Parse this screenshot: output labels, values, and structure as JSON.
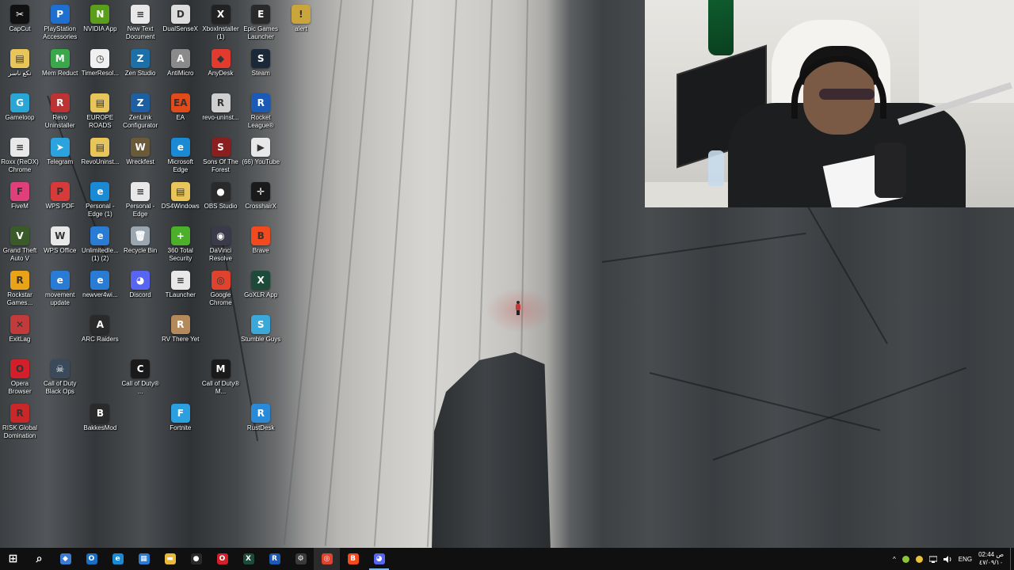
{
  "desktop": {
    "icons": [
      {
        "label": "CapCut",
        "glyph": "✂",
        "color": "#111111",
        "col": 0,
        "row": 0
      },
      {
        "label": "PlayStation Accessories",
        "glyph": "P",
        "color": "#1f6fd1",
        "col": 1,
        "row": 0
      },
      {
        "label": "NVIDIA App",
        "glyph": "N",
        "color": "#5a9e1b",
        "col": 2,
        "row": 0
      },
      {
        "label": "New Text Document",
        "glyph": "≡",
        "color": "#e8e8e8",
        "col": 3,
        "row": 0
      },
      {
        "label": "DualSenseX",
        "glyph": "D",
        "color": "#dcdcdc",
        "col": 4,
        "row": 0
      },
      {
        "label": "XboxInstaller (1)",
        "glyph": "X",
        "color": "#222222",
        "col": 5,
        "row": 0
      },
      {
        "label": "Epic Games Launcher",
        "glyph": "E",
        "color": "#2a2a2a",
        "col": 6,
        "row": 0
      },
      {
        "label": "alert",
        "glyph": "!",
        "color": "#c9a53b",
        "col": 7,
        "row": 0
      },
      {
        "label": "نكع ناسر",
        "glyph": "▤",
        "color": "#e7c55a",
        "col": 0,
        "row": 1
      },
      {
        "label": "Mem Reduct",
        "glyph": "M",
        "color": "#3aa84a",
        "col": 1,
        "row": 1
      },
      {
        "label": "TimerResol...",
        "glyph": "◷",
        "color": "#f0f0f0",
        "col": 2,
        "row": 1
      },
      {
        "label": "Zen Studio",
        "glyph": "Z",
        "color": "#1d6fa8",
        "col": 3,
        "row": 1
      },
      {
        "label": "AntiMicro",
        "glyph": "A",
        "color": "#8a8a8a",
        "col": 4,
        "row": 1
      },
      {
        "label": "AnyDesk",
        "glyph": "◆",
        "color": "#e23a2e",
        "col": 5,
        "row": 1
      },
      {
        "label": "Steam",
        "glyph": "S",
        "color": "#1b2838",
        "col": 6,
        "row": 1
      },
      {
        "label": "Gameloop",
        "glyph": "G",
        "color": "#2aa6d6",
        "col": 0,
        "row": 2
      },
      {
        "label": "Revo Uninstaller",
        "glyph": "R",
        "color": "#b33",
        "col": 1,
        "row": 2
      },
      {
        "label": "EUROPE ROADS",
        "glyph": "▤",
        "color": "#e7c55a",
        "col": 2,
        "row": 2
      },
      {
        "label": "ZenLink Configurator",
        "glyph": "Z",
        "color": "#1d5fa0",
        "col": 3,
        "row": 2
      },
      {
        "label": "EA",
        "glyph": "EA",
        "color": "#e14a1a",
        "col": 4,
        "row": 2
      },
      {
        "label": "revo-uninst...",
        "glyph": "R",
        "color": "#cfcfcf",
        "col": 5,
        "row": 2
      },
      {
        "label": "Rocket League®",
        "glyph": "R",
        "color": "#1c5bb5",
        "col": 6,
        "row": 2
      },
      {
        "label": "Roxx (ReOX) Chrome",
        "glyph": "≡",
        "color": "#e8e8e8",
        "col": 0,
        "row": 3
      },
      {
        "label": "Telegram",
        "glyph": "➤",
        "color": "#2aa3df",
        "col": 1,
        "row": 3
      },
      {
        "label": "RevoUninst...",
        "glyph": "▤",
        "color": "#e7c55a",
        "col": 2,
        "row": 3
      },
      {
        "label": "Wreckfest",
        "glyph": "W",
        "color": "#6b5a3a",
        "col": 3,
        "row": 3
      },
      {
        "label": "Microsoft Edge",
        "glyph": "e",
        "color": "#1a8ad4",
        "col": 4,
        "row": 3
      },
      {
        "label": "Sons Of The Forest",
        "glyph": "S",
        "color": "#8a1f1f",
        "col": 5,
        "row": 3
      },
      {
        "label": "(66) YouTube",
        "glyph": "▶",
        "color": "#e8e8e8",
        "col": 6,
        "row": 3
      },
      {
        "label": "FiveM",
        "glyph": "F",
        "color": "#e0407a",
        "col": 0,
        "row": 4
      },
      {
        "label": "WPS PDF",
        "glyph": "P",
        "color": "#d63a3a",
        "col": 1,
        "row": 4
      },
      {
        "label": "Personal - Edge (1)",
        "glyph": "e",
        "color": "#1a8ad4",
        "col": 2,
        "row": 4
      },
      {
        "label": "Personal - Edge",
        "glyph": "≡",
        "color": "#e8e8e8",
        "col": 3,
        "row": 4
      },
      {
        "label": "DS4Windows",
        "glyph": "▤",
        "color": "#e7c55a",
        "col": 4,
        "row": 4
      },
      {
        "label": "OBS Studio",
        "glyph": "●",
        "color": "#2a2a2a",
        "col": 5,
        "row": 4
      },
      {
        "label": "CrosshairX",
        "glyph": "✛",
        "color": "#1a1a1a",
        "col": 6,
        "row": 4
      },
      {
        "label": "Grand Theft Auto V",
        "glyph": "V",
        "color": "#3a5a2a",
        "col": 0,
        "row": 5
      },
      {
        "label": "WPS Office",
        "glyph": "W",
        "color": "#e8e8e8",
        "col": 1,
        "row": 5
      },
      {
        "label": "UnlimitedIe... (1) (2)",
        "glyph": "e",
        "color": "#2a7bd4",
        "col": 2,
        "row": 5
      },
      {
        "label": "Recycle Bin",
        "glyph": "🗑",
        "color": "#9aa6b0",
        "col": 3,
        "row": 5
      },
      {
        "label": "360 Total Security",
        "glyph": "+",
        "color": "#4caf2a",
        "col": 4,
        "row": 5
      },
      {
        "label": "DaVinci Resolve",
        "glyph": "◉",
        "color": "#3a3a4a",
        "col": 5,
        "row": 5
      },
      {
        "label": "Brave",
        "glyph": "B",
        "color": "#f04a1e",
        "col": 6,
        "row": 5
      },
      {
        "label": "Rockstar Games...",
        "glyph": "R",
        "color": "#e8a318",
        "col": 0,
        "row": 6
      },
      {
        "label": "movement update",
        "glyph": "e",
        "color": "#2a7bd4",
        "col": 1,
        "row": 6
      },
      {
        "label": "newver4wi...",
        "glyph": "e",
        "color": "#2a7bd4",
        "col": 2,
        "row": 6
      },
      {
        "label": "Discord",
        "glyph": "◕",
        "color": "#5865f2",
        "col": 3,
        "row": 6
      },
      {
        "label": "TLauncher",
        "glyph": "≡",
        "color": "#e8e8e8",
        "col": 4,
        "row": 6
      },
      {
        "label": "Google Chrome",
        "glyph": "◎",
        "color": "#e0422e",
        "col": 5,
        "row": 6
      },
      {
        "label": "GoXLR App",
        "glyph": "X",
        "color": "#1e4a3a",
        "col": 6,
        "row": 6
      },
      {
        "label": "ExitLag",
        "glyph": "✕",
        "color": "#c23a3a",
        "col": 0,
        "row": 7
      },
      {
        "label": "ARC Raiders",
        "glyph": "A",
        "color": "#2a2a2a",
        "col": 2,
        "row": 7
      },
      {
        "label": "RV There Yet",
        "glyph": "R",
        "color": "#b58a5a",
        "col": 4,
        "row": 7
      },
      {
        "label": "Stumble Guys",
        "glyph": "S",
        "color": "#3aa8d8",
        "col": 6,
        "row": 7
      },
      {
        "label": "Opera Browser",
        "glyph": "O",
        "color": "#d21f2a",
        "col": 0,
        "row": 8
      },
      {
        "label": "Call of Duty Black Ops",
        "glyph": "☠",
        "color": "#3a4a5a",
        "col": 1,
        "row": 8
      },
      {
        "label": "Call of Duty® ...",
        "glyph": "C",
        "color": "#1a1a1a",
        "col": 3,
        "row": 8
      },
      {
        "label": "Call of Duty® M...",
        "glyph": "M",
        "color": "#1a1a1a",
        "col": 5,
        "row": 8
      },
      {
        "label": "RISK Global Domination",
        "glyph": "R",
        "color": "#c8282a",
        "col": 0,
        "row": 9
      },
      {
        "label": "BakkesMod",
        "glyph": "B",
        "color": "#2a2a2a",
        "col": 2,
        "row": 9
      },
      {
        "label": "Fortnite",
        "glyph": "F",
        "color": "#2aa0e0",
        "col": 4,
        "row": 9
      },
      {
        "label": "RustDesk",
        "glyph": "R",
        "color": "#2a8ad8",
        "col": 6,
        "row": 9
      }
    ]
  },
  "taskbar": {
    "buttons": [
      {
        "name": "start-button",
        "icon": "windows-logo-icon",
        "glyph": "⊞",
        "color": "#101010",
        "state": ""
      },
      {
        "name": "search-button",
        "icon": "search-icon",
        "glyph": "⌕",
        "color": "#101010",
        "state": ""
      },
      {
        "name": "taskbar-copilot",
        "icon": "copilot-icon",
        "glyph": "◆",
        "color": "#3a7bd5",
        "state": ""
      },
      {
        "name": "taskbar-outlook",
        "icon": "outlook-icon",
        "glyph": "O",
        "color": "#1a6fc4",
        "state": ""
      },
      {
        "name": "taskbar-edge",
        "icon": "edge-icon",
        "glyph": "e",
        "color": "#1a8ad4",
        "state": ""
      },
      {
        "name": "taskbar-store",
        "icon": "store-icon",
        "glyph": "▦",
        "color": "#2a7bd4",
        "state": ""
      },
      {
        "name": "taskbar-file-explorer",
        "icon": "folder-icon",
        "glyph": "▬",
        "color": "#e8b93a",
        "state": ""
      },
      {
        "name": "taskbar-obs",
        "icon": "obs-icon",
        "glyph": "●",
        "color": "#2a2a2a",
        "state": ""
      },
      {
        "name": "taskbar-opera",
        "icon": "opera-icon",
        "glyph": "O",
        "color": "#d21f2a",
        "state": ""
      },
      {
        "name": "taskbar-goxlr",
        "icon": "goxlr-icon",
        "glyph": "X",
        "color": "#1e4a3a",
        "state": ""
      },
      {
        "name": "taskbar-rocket-league",
        "icon": "rocket-league-icon",
        "glyph": "R",
        "color": "#1c5bb5",
        "state": ""
      },
      {
        "name": "taskbar-settings",
        "icon": "gear-icon",
        "glyph": "⚙",
        "color": "#3a3a3a",
        "state": ""
      },
      {
        "name": "taskbar-chrome",
        "icon": "chrome-icon",
        "glyph": "◎",
        "color": "#e0422e",
        "state": "active"
      },
      {
        "name": "taskbar-brave",
        "icon": "brave-icon",
        "glyph": "B",
        "color": "#f04a1e",
        "state": ""
      },
      {
        "name": "taskbar-discord",
        "icon": "discord-icon",
        "glyph": "◕",
        "color": "#5865f2",
        "state": "running"
      }
    ],
    "tray": {
      "chevron": "^",
      "language": "ENG",
      "time": "02:44 ص",
      "date": "٤٧/٠٩/١٠"
    }
  }
}
